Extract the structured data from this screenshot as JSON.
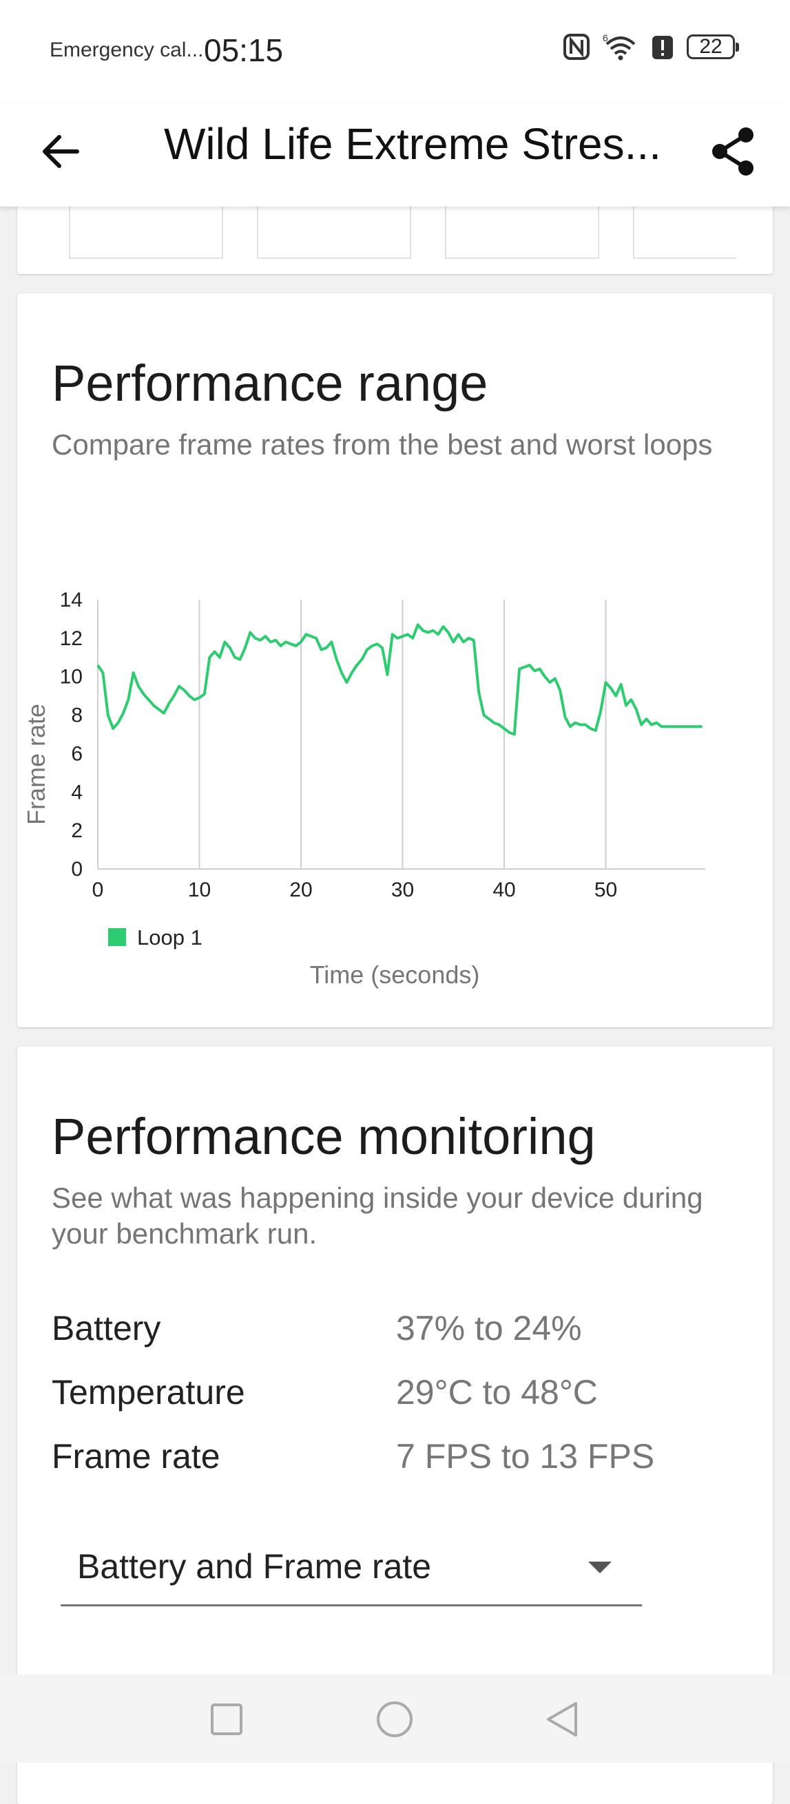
{
  "status_bar": {
    "carrier_text": "Emergency cal...",
    "time": "05:15",
    "battery_level": "22",
    "icons": [
      "nfc-icon",
      "wifi-icon",
      "alert-icon",
      "battery-icon"
    ]
  },
  "app_bar": {
    "title": "Wild Life Extreme Stres...",
    "back_icon": "arrow-left-icon",
    "share_icon": "share-icon"
  },
  "performance_range": {
    "title": "Performance range",
    "subtitle": "Compare frame rates from the best and worst loops"
  },
  "chart_data": {
    "type": "line",
    "xlabel": "Time (seconds)",
    "ylabel": "Frame rate",
    "xlim": [
      0,
      60
    ],
    "ylim": [
      0,
      14
    ],
    "x_ticks": [
      0,
      10,
      20,
      30,
      40,
      50
    ],
    "y_ticks": [
      0,
      2,
      4,
      6,
      8,
      10,
      12,
      14
    ],
    "grid": "vertical",
    "legend": "bottom-left",
    "series": [
      {
        "name": "Loop 1",
        "color": "#2ecc71",
        "x": [
          0,
          0.5,
          1,
          1.5,
          2,
          2.5,
          3,
          3.5,
          4,
          4.5,
          5,
          5.5,
          6,
          6.5,
          7,
          7.5,
          8,
          8.5,
          9,
          9.5,
          10,
          10.5,
          11,
          11.5,
          12,
          12.5,
          13,
          13.5,
          14,
          14.5,
          15,
          15.5,
          16,
          16.5,
          17,
          17.5,
          18,
          18.5,
          19,
          19.5,
          20,
          20.5,
          21,
          21.5,
          22,
          22.5,
          23,
          23.5,
          24,
          24.5,
          25,
          25.5,
          26,
          26.5,
          27,
          27.5,
          28,
          28.5,
          29,
          29.5,
          30,
          30.5,
          31,
          31.5,
          32,
          32.5,
          33,
          33.5,
          34,
          34.5,
          35,
          35.5,
          36,
          36.5,
          37,
          37.5,
          38,
          38.5,
          39,
          39.5,
          40,
          40.5,
          41,
          41.5,
          42,
          42.5,
          43,
          43.5,
          44,
          44.5,
          45,
          45.5,
          46,
          46.5,
          47,
          47.5,
          48,
          48.5,
          49,
          49.5,
          50,
          50.5,
          51,
          51.5,
          52,
          52.5,
          53,
          53.5,
          54,
          54.5,
          55,
          55.5,
          56,
          56.5,
          57,
          57.5,
          58,
          58.5,
          59,
          59.5
        ],
        "values": [
          10.6,
          10.2,
          8.0,
          7.3,
          7.6,
          8.1,
          8.8,
          10.2,
          9.5,
          9.1,
          8.8,
          8.5,
          8.3,
          8.1,
          8.6,
          9.0,
          9.5,
          9.3,
          9.0,
          8.8,
          8.9,
          9.1,
          11.0,
          11.3,
          11.0,
          11.8,
          11.5,
          11.0,
          10.9,
          11.5,
          12.3,
          12.0,
          11.9,
          12.1,
          11.8,
          11.9,
          11.6,
          11.8,
          11.7,
          11.6,
          11.8,
          12.2,
          12.1,
          12.0,
          11.4,
          11.5,
          11.8,
          10.9,
          10.2,
          9.7,
          10.2,
          10.6,
          10.9,
          11.4,
          11.6,
          11.7,
          11.5,
          10.1,
          12.2,
          12.0,
          12.1,
          12.2,
          12.0,
          12.7,
          12.4,
          12.3,
          12.4,
          12.2,
          12.6,
          12.3,
          11.8,
          12.2,
          11.8,
          12.0,
          11.9,
          9.2,
          8.0,
          7.8,
          7.6,
          7.5,
          7.3,
          7.1,
          7.0,
          10.4,
          10.5,
          10.6,
          10.3,
          10.4,
          10.0,
          9.7,
          9.9,
          9.3,
          7.9,
          7.4,
          7.6,
          7.5,
          7.5,
          7.3,
          7.2,
          8.2,
          9.7,
          9.4,
          9.0,
          9.6,
          8.5,
          8.8,
          8.3,
          7.5,
          7.8,
          7.5,
          7.6,
          7.4,
          7.4,
          7.4,
          7.4,
          7.4,
          7.4,
          7.4,
          7.4,
          7.4
        ]
      }
    ]
  },
  "performance_monitoring": {
    "title": "Performance monitoring",
    "subtitle": "See what was happening inside your device during your benchmark run.",
    "rows": [
      {
        "label": "Battery",
        "value": "37% to 24%"
      },
      {
        "label": "Temperature",
        "value": "29°C to 48°C"
      },
      {
        "label": "Frame rate",
        "value": "7 FPS to 13 FPS"
      }
    ],
    "dropdown_value": "Battery and Frame rate"
  },
  "nav_bar": {
    "buttons": [
      "recents-square-icon",
      "home-circle-icon",
      "back-triangle-icon"
    ]
  }
}
